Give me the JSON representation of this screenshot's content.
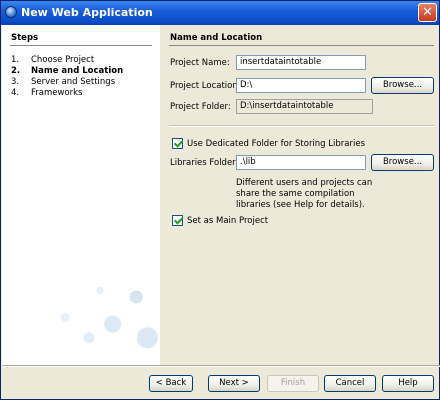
{
  "window": {
    "title": "New Web Application",
    "close_glyph": "✕"
  },
  "steps": {
    "title": "Steps",
    "items": [
      {
        "num": "1.",
        "label": "Choose Project"
      },
      {
        "num": "2.",
        "label": "Name and Location"
      },
      {
        "num": "3.",
        "label": "Server and Settings"
      },
      {
        "num": "4.",
        "label": "Frameworks"
      }
    ]
  },
  "main": {
    "section_title": "Name and Location",
    "project_name": {
      "label": "Project Name:",
      "value": "insertdataintotable"
    },
    "project_location": {
      "label": "Project Location:",
      "value": "D:\\",
      "browse": "Browse..."
    },
    "project_folder": {
      "label": "Project Folder:",
      "value": "D:\\insertdataintotable"
    },
    "dedicated_folder": {
      "label": "Use Dedicated Folder for Storing Libraries",
      "checked": true
    },
    "libraries_folder": {
      "label": "Libraries Folder:",
      "value": ".\\lib",
      "browse": "Browse..."
    },
    "help_lines": [
      "Different users and projects can",
      "share the same compilation",
      "libraries (see Help for details)."
    ],
    "main_project": {
      "label": "Set as Main Project",
      "checked": true
    }
  },
  "buttons": {
    "back": "< Back",
    "next": "Next >",
    "finish": "Finish",
    "cancel": "Cancel",
    "help": "Help"
  },
  "colors": {
    "titlebar": "#0b4bc7",
    "dialog_bg": "#ece9d8",
    "accent_check": "#21a121"
  }
}
